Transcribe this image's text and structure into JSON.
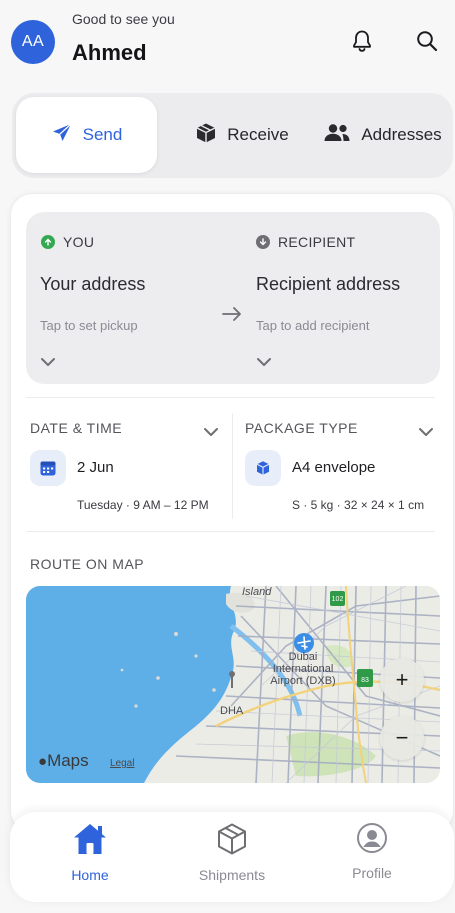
{
  "header": {
    "avatar_initials": "AA",
    "greeting": "Good to see you",
    "user_name": "Ahmed"
  },
  "tabs": [
    {
      "label": "Send",
      "icon": "paper-plane-icon",
      "active": true
    },
    {
      "label": "Receive",
      "icon": "package-box-icon",
      "active": false
    },
    {
      "label": "Addresses",
      "icon": "people-icon",
      "active": false
    }
  ],
  "sender": {
    "heading": "YOU",
    "title": "Your address",
    "subtitle": "Tap to set pickup",
    "status_color": "#34a853"
  },
  "recipient": {
    "heading": "RECIPIENT",
    "title": "Recipient address",
    "subtitle": "Tap to add recipient",
    "status_color": "#6e6e73"
  },
  "date_time": {
    "label": "DATE & TIME",
    "value": "2 Jun",
    "detail": "Tuesday · 9 AM – 12 PM",
    "icon": "calendar-icon"
  },
  "package_type": {
    "label": "PACKAGE TYPE",
    "value": "A4 envelope",
    "detail": "S · 5 kg · 32 × 24 × 1 cm",
    "icon": "box-icon"
  },
  "route": {
    "label": "ROUTE ON MAP",
    "map_labels": {
      "island": "Island",
      "airport": "Dubai International Airport (DXB)",
      "dha": "DHA",
      "shield_1": "102",
      "shield_2": "83"
    },
    "attribution": "Maps",
    "legal": "Legal",
    "zoom_in": "+",
    "zoom_out": "−"
  },
  "bottom_nav": [
    {
      "label": "Home",
      "icon": "home-icon",
      "active": true
    },
    {
      "label": "Shipments",
      "icon": "cube-icon",
      "active": false
    },
    {
      "label": "Profile",
      "icon": "user-circle-icon",
      "active": false
    }
  ],
  "colors": {
    "accent": "#2f63dc",
    "background": "#f7f7f8",
    "card": "#ffffff",
    "panel": "#ededf0"
  }
}
